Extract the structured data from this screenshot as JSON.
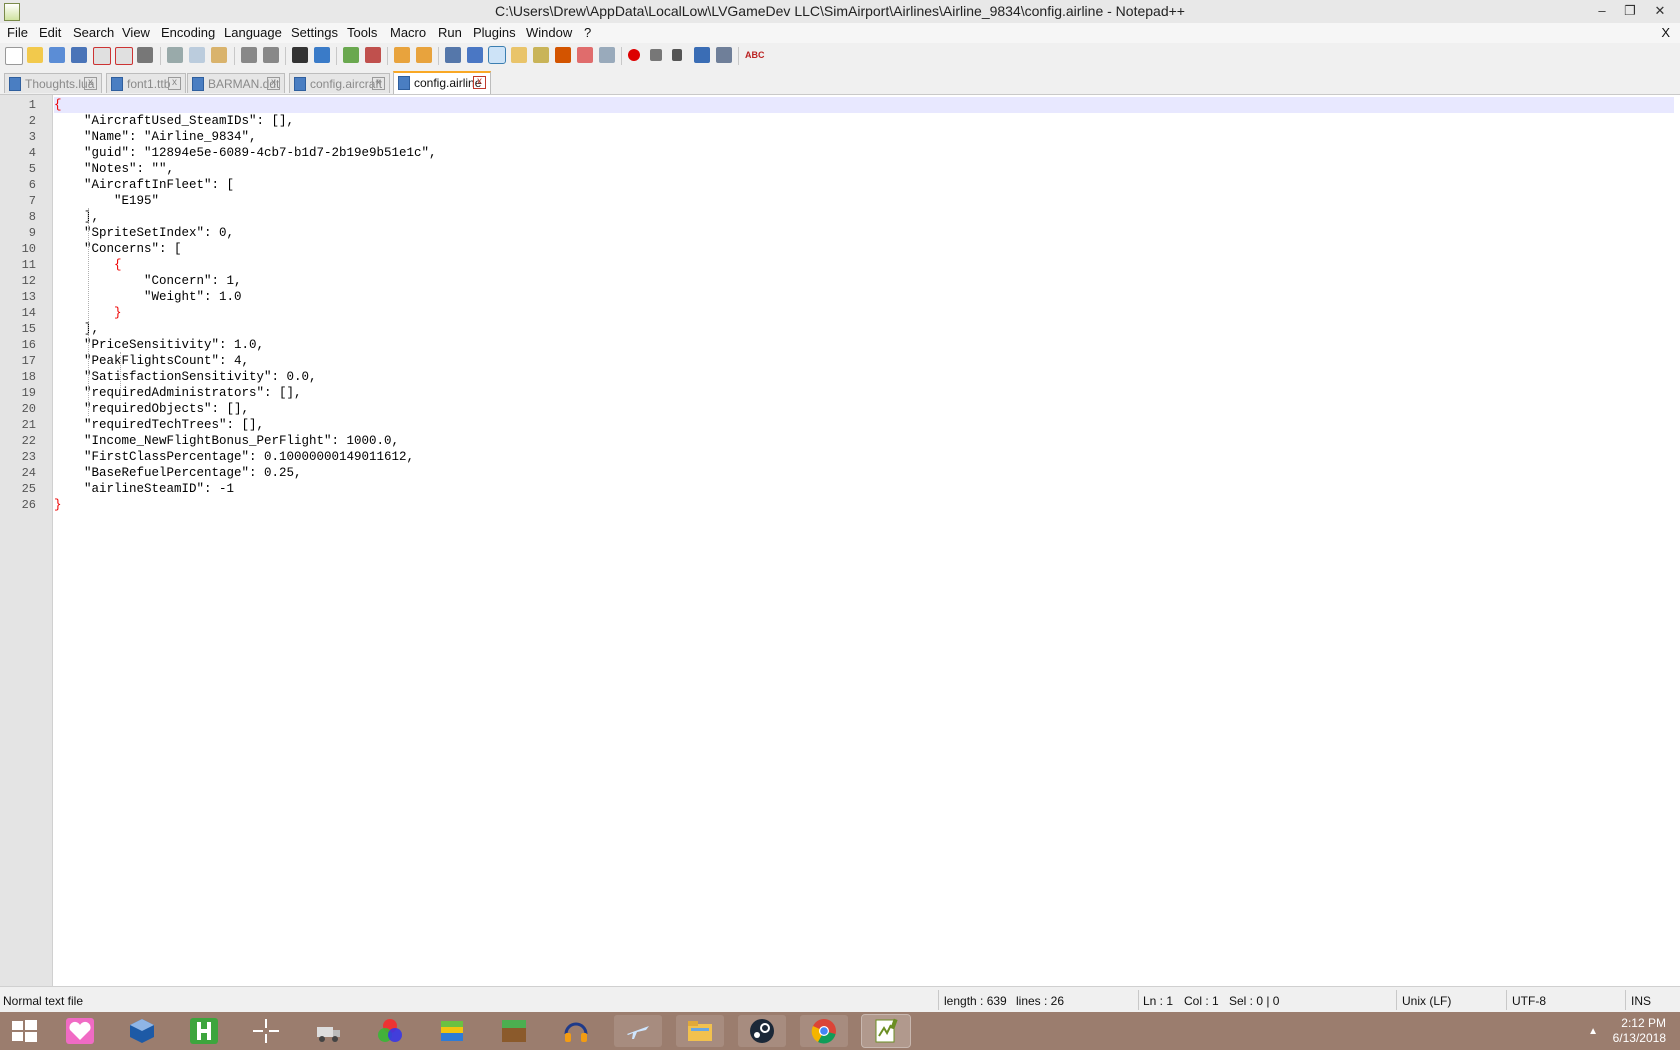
{
  "window": {
    "title": "C:\\Users\\Drew\\AppData\\LocalLow\\LVGameDev LLC\\SimAirport\\Airlines\\Airline_9834\\config.airline - Notepad++",
    "minimize": "–",
    "maximize": "❐",
    "close": "✕"
  },
  "menu": {
    "items": [
      "File",
      "Edit",
      "Search",
      "View",
      "Encoding",
      "Language",
      "Settings",
      "Tools",
      "Macro",
      "Run",
      "Plugins",
      "Window",
      "?"
    ],
    "close_doc": "X"
  },
  "toolbar": {
    "icons": [
      "new-file-icon",
      "open-file-icon",
      "save-icon",
      "save-all-icon",
      "close-icon",
      "close-all-icon",
      "print-icon",
      "cut-icon",
      "copy-icon",
      "paste-icon",
      "undo-icon",
      "redo-icon",
      "find-icon",
      "replace-icon",
      "zoom-in-icon",
      "zoom-out-icon",
      "sync-vertical-icon",
      "sync-horizontal-icon",
      "word-wrap-icon",
      "show-all-chars-icon",
      "indent-guide-icon",
      "user-language-icon",
      "doc-map-icon",
      "function-list-icon",
      "folder-as-workspace-icon",
      "monitoring-icon",
      "record-macro-icon",
      "stop-record-icon",
      "playback-macro-icon",
      "run-macro-multiple-icon",
      "save-macro-icon",
      "spellcheck-icon"
    ],
    "spellcheck_label": "ABC"
  },
  "tabs": [
    {
      "label": "Thoughts.lua",
      "active": false
    },
    {
      "label": "font1.ttb",
      "active": false
    },
    {
      "label": "BARMAN.ddt",
      "active": false
    },
    {
      "label": "config.aircraft",
      "active": false
    },
    {
      "label": "config.airline",
      "active": true
    }
  ],
  "editor": {
    "lines": [
      "{",
      "    \"AircraftUsed_SteamIDs\": [],",
      "    \"Name\": \"Airline_9834\",",
      "    \"guid\": \"12894e5e-6089-4cb7-b1d7-2b19e9b51e1c\",",
      "    \"Notes\": \"\",",
      "    \"AircraftInFleet\": [",
      "        \"E195\"",
      "    ],",
      "    \"SpriteSetIndex\": 0,",
      "    \"Concerns\": [",
      "        {",
      "            \"Concern\": 1,",
      "            \"Weight\": 1.0",
      "        }",
      "    ],",
      "    \"PriceSensitivity\": 1.0,",
      "    \"PeakFlightsCount\": 4,",
      "    \"SatisfactionSensitivity\": 0.0,",
      "    \"requiredAdministrators\": [],",
      "    \"requiredObjects\": [],",
      "    \"requiredTechTrees\": [],",
      "    \"Income_NewFlightBonus_PerFlight\": 1000.0,",
      "    \"FirstClassPercentage\": 0.10000000149011612,",
      "    \"BaseRefuelPercentage\": 0.25,",
      "    \"airlineSteamID\": -1",
      "}"
    ],
    "current_line": 1
  },
  "status": {
    "file_type": "Normal text file",
    "length": "length : 639",
    "lines": "lines : 26",
    "ln": "Ln : 1",
    "col": "Col : 1",
    "sel": "Sel : 0 | 0",
    "eol": "Unix (LF)",
    "encoding": "UTF-8",
    "mode": "INS"
  },
  "taskbar": {
    "apps": [
      "windows-start-icon",
      "heart-app-icon",
      "virtualbox-icon",
      "h-app-icon",
      "crosshair-app-icon",
      "truck-game-icon",
      "rgb-circles-icon",
      "bluestacks-icon",
      "minecraft-icon",
      "audio-headphones-icon",
      "airplane-app-icon",
      "file-explorer-icon",
      "steam-icon",
      "chrome-icon",
      "notepadpp-icon"
    ],
    "active_index": 14,
    "tray_arrow": "▲",
    "time": "2:12 PM",
    "date": "6/13/2018"
  }
}
